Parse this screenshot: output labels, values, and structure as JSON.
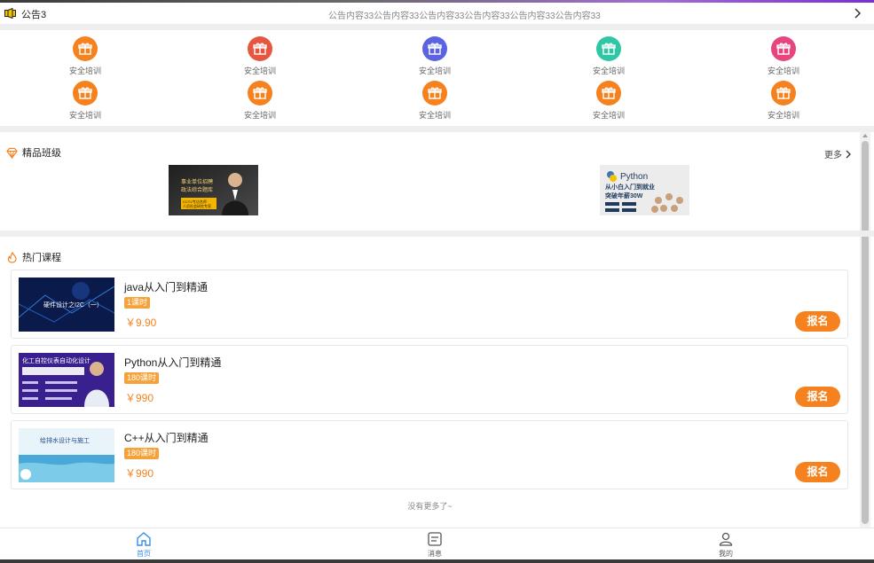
{
  "notice": {
    "title": "公告3",
    "text": "公告内容33公告内容33公告内容33公告内容33公告内容33公告内容33",
    "speaker_color": "#f2c200"
  },
  "categories": [
    {
      "label": "安全培训",
      "color": "#f5821f"
    },
    {
      "label": "安全培训",
      "color": "#e6573f"
    },
    {
      "label": "安全培训",
      "color": "#5b63e0"
    },
    {
      "label": "安全培训",
      "color": "#2fc6a6"
    },
    {
      "label": "安全培训",
      "color": "#e6457f"
    },
    {
      "label": "安全培训",
      "color": "#f5821f"
    },
    {
      "label": "安全培训",
      "color": "#f5821f"
    },
    {
      "label": "安全培训",
      "color": "#f5821f"
    },
    {
      "label": "安全培训",
      "color": "#f5821f"
    },
    {
      "label": "安全培训",
      "color": "#f5821f"
    }
  ],
  "featured": {
    "title": "精品班级",
    "more_label": "更多",
    "banners": [
      {
        "lines": [
          "事业单位招聘",
          "政法综合题库",
          "CCTV专访名师",
          "人员社会研究专家"
        ]
      },
      {
        "lines": [
          "Python",
          "从小白入门到就业",
          "突破年薪30W"
        ]
      }
    ]
  },
  "hot": {
    "title": "热门课程",
    "courses": [
      {
        "title": "java从入门到精通",
        "badge": "1课时",
        "price": "￥9.90",
        "enroll_label": "报名",
        "image_caption": "硬件设计之I2C（一）"
      },
      {
        "title": "Python从入门到精通",
        "badge": "180课时",
        "price": "￥990",
        "enroll_label": "报名",
        "image_caption": "化工自控仪表自动化设计"
      },
      {
        "title": "C++从入门到精通",
        "badge": "180课时",
        "price": "￥990",
        "enroll_label": "报名",
        "image_caption": "给排水设计与施工"
      }
    ]
  },
  "no_more": "没有更多了~",
  "tabs": [
    {
      "label": "首页",
      "icon": "home-icon",
      "active": true
    },
    {
      "label": "消息",
      "icon": "message-icon",
      "active": false
    },
    {
      "label": "我的",
      "icon": "user-icon",
      "active": false
    }
  ],
  "colors": {
    "accent": "#f5821f",
    "active_tab": "#3a8ee6",
    "badge": "#f5a23a"
  }
}
